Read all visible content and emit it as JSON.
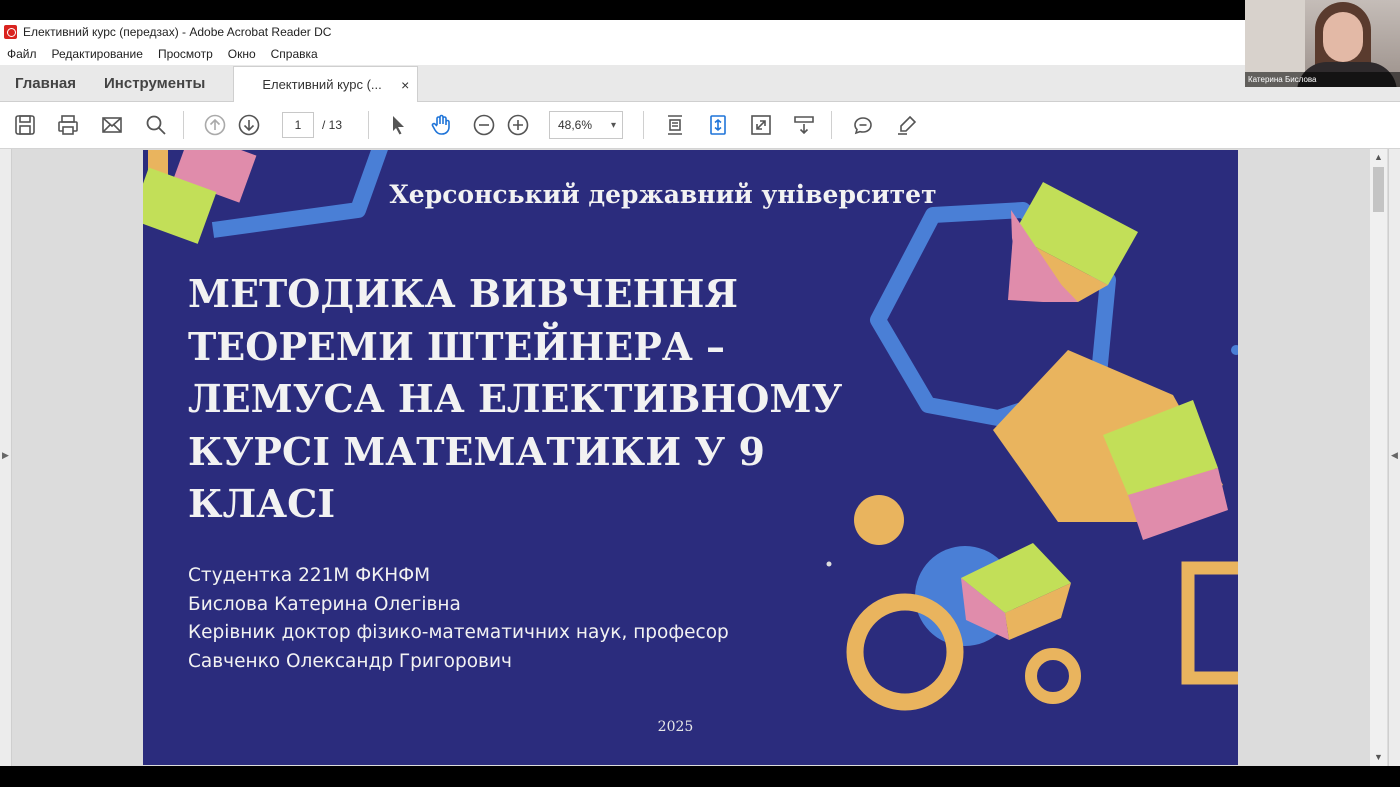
{
  "window": {
    "title": "Елективний курс (передзах) - Adobe Acrobat Reader DC"
  },
  "menu": [
    "Файл",
    "Редактирование",
    "Просмотр",
    "Окно",
    "Справка"
  ],
  "tabs": {
    "home": "Главная",
    "tools": "Инструменты",
    "document": "Елективний курс (...",
    "close_glyph": "×"
  },
  "toolbar": {
    "page_current": "1",
    "page_total": "/ 13",
    "zoom": "48,6%",
    "zoom_dropdown_glyph": "▾"
  },
  "slide": {
    "university": "Херсонський державний університет",
    "title_lines": [
      "МЕТОДИКА ВИВЧЕННЯ",
      "ТЕОРЕМИ ШТЕЙНЕРА –",
      "ЛЕМУСА НА ЕЛЕКТИВНОМУ",
      "КУРСІ МАТЕМАТИКИ  У 9",
      "КЛАСІ"
    ],
    "author_lines": [
      "Студентка 221М ФКНФМ",
      "Бислова Катерина Олегівна",
      "Керівник доктор фізико-математичних наук, професор",
      "Савченко Олександр Григорович"
    ],
    "year": "2025",
    "colors": {
      "background": "#2b2c7d",
      "blue": "#4a7fd6",
      "orange": "#e9b45e",
      "green": "#c2df58",
      "pink": "#e08cab"
    }
  },
  "webcam": {
    "participant_name": "Катерина Бислова"
  },
  "icons": {
    "save": "save-icon",
    "print": "print-icon",
    "mail": "mail-icon",
    "search": "search-icon",
    "prev_page": "arrow-up-circle-icon",
    "next_page": "arrow-down-circle-icon",
    "select": "cursor-arrow-icon",
    "hand": "hand-icon",
    "zoom_out": "zoom-out-icon",
    "zoom_in": "zoom-in-icon",
    "fit_page": "fit-page-icon",
    "scroll_mode": "scroll-mode-icon",
    "full_screen": "full-screen-icon",
    "read_mode": "read-mode-icon",
    "comment": "comment-icon",
    "highlight": "highlight-pen-icon"
  }
}
